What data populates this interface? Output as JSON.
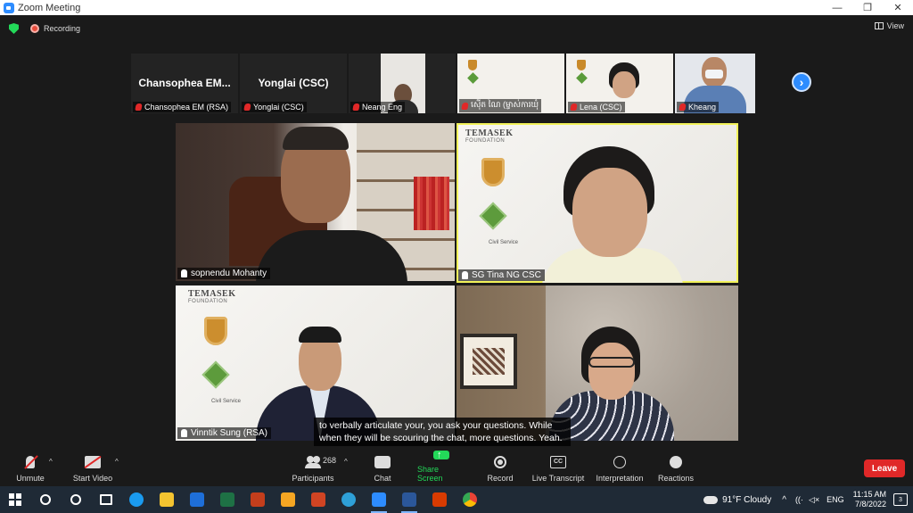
{
  "window": {
    "title": "Zoom Meeting",
    "minimize": "—",
    "restore": "❐",
    "close": "✕"
  },
  "status": {
    "recording_label": "Recording",
    "view_label": "View"
  },
  "thumbnails": [
    {
      "big_name": "Chansophea  EM...",
      "label": "Chansophea EM (RSA)",
      "video": false
    },
    {
      "big_name": "Yonglai (CSC)",
      "label": "Yonglai (CSC)",
      "video": false
    },
    {
      "big_name": "",
      "label": "Neang Eng",
      "video": true
    },
    {
      "big_name": "",
      "label": "ស៊ើត ណៃ (ម្ចាស់ការឃុំ",
      "video": true
    },
    {
      "big_name": "",
      "label": "Lena (CSC)",
      "video": true
    },
    {
      "big_name": "",
      "label": "Kheang",
      "video": true
    }
  ],
  "next_arrow": "›",
  "gallery": [
    {
      "name": "sopnendu Mohanty"
    },
    {
      "name": "SG Tina NG CSC",
      "tf_title": "TEMASEK",
      "tf_sub": "FOUNDATION",
      "cs": "Civil Service"
    },
    {
      "name": "Vinntik Sung (RSA)",
      "tf_title": "TEMASEK",
      "tf_sub": "FOUNDATION",
      "cs": "Civil Service"
    },
    {
      "name": ""
    }
  ],
  "captions": {
    "line1": "to verbally articulate your, you ask your questions. While",
    "line2": "when they will be scouring the chat, more questions. Yeah."
  },
  "toolbar": {
    "unmute": "Unmute",
    "start_video": "Start Video",
    "participants": "Participants",
    "participant_count": "268",
    "chat": "Chat",
    "share_screen": "Share Screen",
    "record": "Record",
    "live_transcript": "Live Transcript",
    "cc": "CC",
    "interpretation": "Interpretation",
    "reactions": "Reactions",
    "leave": "Leave",
    "caret": "^"
  },
  "taskbar": {
    "weather": "91°F  Cloudy",
    "lang": "ENG",
    "time": "11:15 AM",
    "date": "7/8/2022",
    "notif_count": "3",
    "app_colors": [
      "#1a9bf0",
      "#f4c430",
      "#1e6fd9",
      "#1e7145",
      "#c43e1c",
      "#f5a623",
      "#c43e1c",
      "#2ea0d8",
      "#2d8cff",
      "#2b579a",
      "#d83b01",
      "#34a853"
    ]
  }
}
